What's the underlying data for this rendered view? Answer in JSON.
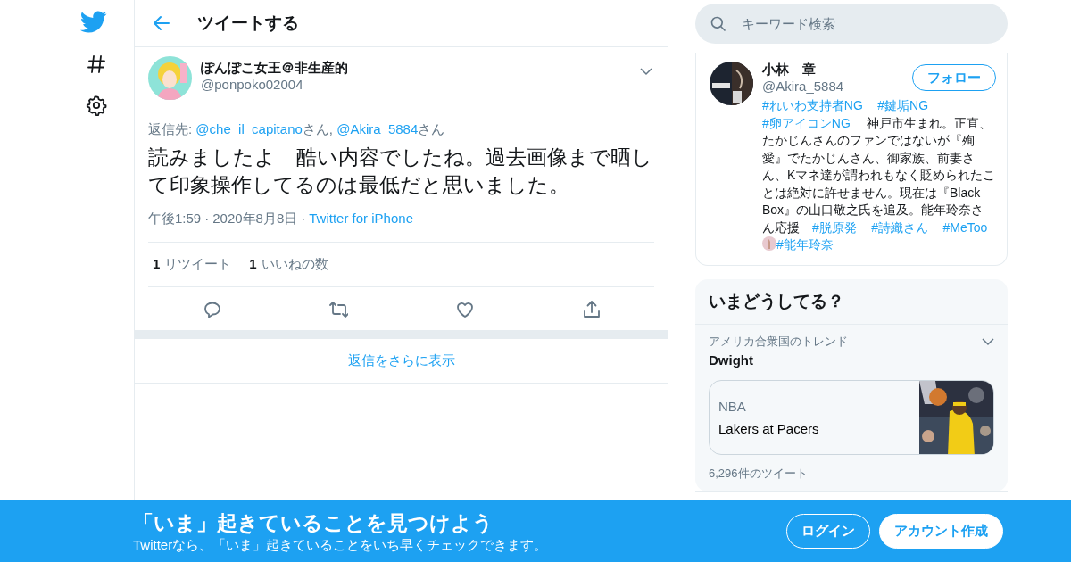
{
  "nav": {
    "items": [
      {
        "kind": "logo"
      },
      {
        "kind": "explore"
      },
      {
        "kind": "settings"
      }
    ]
  },
  "header": {
    "title": "ツイートする"
  },
  "tweet": {
    "author": {
      "name": "ぽんぽこ女王＠非生産的",
      "handle": "@ponpoko02004"
    },
    "reply_to": [
      {
        "text": "返信先: ",
        "kind": "plain"
      },
      {
        "text": "@che_il_capitano",
        "kind": "link"
      },
      {
        "text": "さん, ",
        "kind": "plain"
      },
      {
        "text": "@Akira_5884",
        "kind": "link"
      },
      {
        "text": "さん",
        "kind": "plain"
      }
    ],
    "text": "読みましたよ　酷い内容でしたね。過去画像まで晒して印象操作してるのは最低だと思いました。",
    "time": "午後1:59",
    "separator": "·",
    "date": "2020年8月8日",
    "source": "Twitter for iPhone",
    "stats": [
      {
        "count": "1",
        "label": "リツイート"
      },
      {
        "count": "1",
        "label": "いいねの数"
      }
    ],
    "actions": [
      {
        "kind": "reply"
      },
      {
        "kind": "retweet"
      },
      {
        "kind": "like"
      },
      {
        "kind": "share"
      }
    ]
  },
  "more_replies": "返信をさらに表示",
  "search": {
    "placeholder": "キーワード検索"
  },
  "profile": {
    "name": "小林　章",
    "handle": "@Akira_5884",
    "follow": "フォロー",
    "bio": [
      {
        "text": "#れいわ支持者NG",
        "kind": "hashtag"
      },
      {
        "text": "#鍵垢NG",
        "kind": "hashtag"
      },
      {
        "text": "#卵アイコンNG",
        "kind": "hashtag"
      },
      {
        "text": "　神戸市生まれ。正直、たかじんさんのファンではないが『殉愛』でたかじんさん、御家族、前妻さん、Kマネ達が謂われもなく貶められたことは絶対に許せません。現在は『Black Box』の山口敬之氏を追及。能年玲奈さん応援　",
        "kind": "plain"
      },
      {
        "text": "#脱原発",
        "kind": "hashtag"
      },
      {
        "text": "#詩織さん",
        "kind": "hashtag"
      },
      {
        "text": "#MeToo",
        "kind": "hashtag"
      },
      {
        "kind": "emoji"
      },
      {
        "text": "#能年玲奈",
        "kind": "hashtag"
      }
    ]
  },
  "trends": {
    "title": "いまどうしてる？",
    "items": [
      {
        "context": "アメリカ合衆国のトレンド",
        "name": "Dwight",
        "card": {
          "category": "NBA",
          "title": "Lakers at Pacers"
        },
        "count": "6,296件のツイート"
      }
    ]
  },
  "banner": {
    "title": "「いま」起きていることを見つけよう",
    "subtitle": "Twitterなら、「いま」起きていることをいち早くチェックできます。",
    "buttons": [
      {
        "label": "ログイン",
        "kind": "outline"
      },
      {
        "label": "アカウント作成",
        "kind": "filled"
      }
    ]
  }
}
